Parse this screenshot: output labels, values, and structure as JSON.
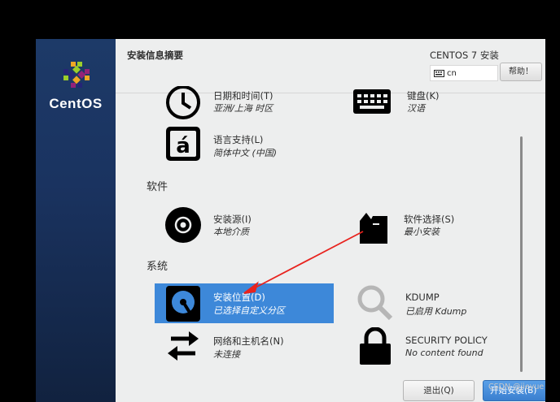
{
  "brand": {
    "name": "CentOS"
  },
  "header": {
    "title": "安装信息摘要",
    "product": "CENTOS 7 安装",
    "keyboard_layout": "cn",
    "help_label": "帮助！"
  },
  "categories": {
    "software": "软件",
    "system": "系统"
  },
  "spokes": {
    "datetime": {
      "title": "日期和时间(T)",
      "status": "亚洲/上海 时区"
    },
    "keyboard": {
      "title": "键盘(K)",
      "status": "汉语"
    },
    "language": {
      "title": "语言支持(L)",
      "status": "简体中文 (中国)"
    },
    "source": {
      "title": "安装源(I)",
      "status": "本地介质"
    },
    "software_selection": {
      "title": "软件选择(S)",
      "status": "最小安装"
    },
    "destination": {
      "title": "安装位置(D)",
      "status": "已选择自定义分区"
    },
    "kdump": {
      "title": "KDUMP",
      "status": "已启用 Kdump"
    },
    "network": {
      "title": "网络和主机名(N)",
      "status": "未连接"
    },
    "security": {
      "title": "SECURITY POLICY",
      "status": "No content found"
    }
  },
  "footer": {
    "quit_label": "退出(Q)",
    "begin_label": "开始安装(B)"
  },
  "watermark": "CSDN @jieyue",
  "colors": {
    "accent": "#3d88d9",
    "annotation_arrow": "#e8231e",
    "sidebar": "#1a3360"
  }
}
